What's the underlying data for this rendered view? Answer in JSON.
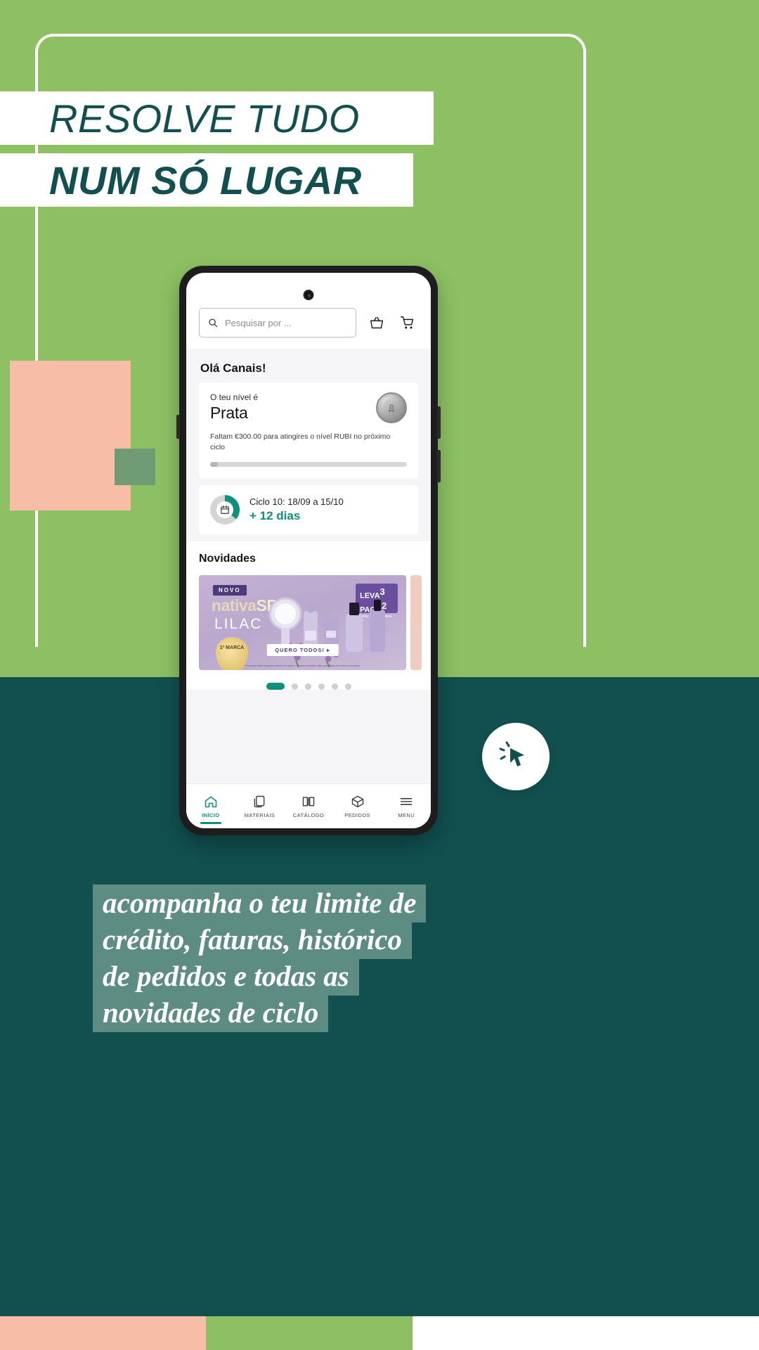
{
  "poster": {
    "headline_line1": "RESOLVE TUDO",
    "headline_line2": "NUM SÓ LUGAR",
    "copy_lines": [
      "acompanha o teu limite de",
      "crédito, faturas, histórico",
      "de pedidos e todas as",
      "novidades de ciclo"
    ],
    "colors": {
      "green": "#8cc063",
      "teal": "#11504f",
      "peach": "#f7bda6",
      "sage": "#6f9c74",
      "accent": "#0f8f7e",
      "copy_bar": "#5d8d82"
    }
  },
  "app": {
    "search": {
      "placeholder": "Pesquisar por ...",
      "icon": "search-icon"
    },
    "header_icons": [
      {
        "name": "basket-icon"
      },
      {
        "name": "cart-icon"
      }
    ],
    "greeting": "Olá Canais!",
    "level_card": {
      "label": "O teu nível é",
      "level": "Prata",
      "note": "Faltam €300.00 para atingires o nível RUBI no próximo ciclo",
      "progress_percent": 4,
      "badge_icon": "silver-medal-icon"
    },
    "cycle_card": {
      "icon": "calendar-icon",
      "title": "Ciclo 10: 18/09 a 15/10",
      "remaining": "+ 12 dias",
      "donut_percent": 36
    },
    "news": {
      "title": "Novidades",
      "banner": {
        "tag": "NOVO",
        "brand_part1": "nativa",
        "brand_part2": "SPA",
        "product_line": "LILAC",
        "seal_text": "1ª MARCA",
        "promo_line1": "LEVA",
        "promo_num1": "3",
        "promo_line2": "PAGA",
        "promo_num2": "2",
        "promo_note": "em toda a gama Nativa SPA*",
        "cta": "QUERO TODOS! ▸",
        "legal": "*Promoção válida enquanto durarem os stocks. Consulte condições. Não acumulável com outras promoções."
      },
      "dots_total": 6,
      "dots_active_index": 0
    },
    "bottom_nav": [
      {
        "label": "INÍCIO",
        "icon": "home-icon",
        "active": true
      },
      {
        "label": "MATERIAIS",
        "icon": "documents-icon",
        "active": false
      },
      {
        "label": "CATÁLOGO",
        "icon": "book-icon",
        "active": false
      },
      {
        "label": "PEDIDOS",
        "icon": "box-icon",
        "active": false
      },
      {
        "label": "MENU",
        "icon": "hamburger-icon",
        "active": false
      }
    ]
  },
  "cursor_badge": {
    "icon": "click-cursor-icon"
  }
}
